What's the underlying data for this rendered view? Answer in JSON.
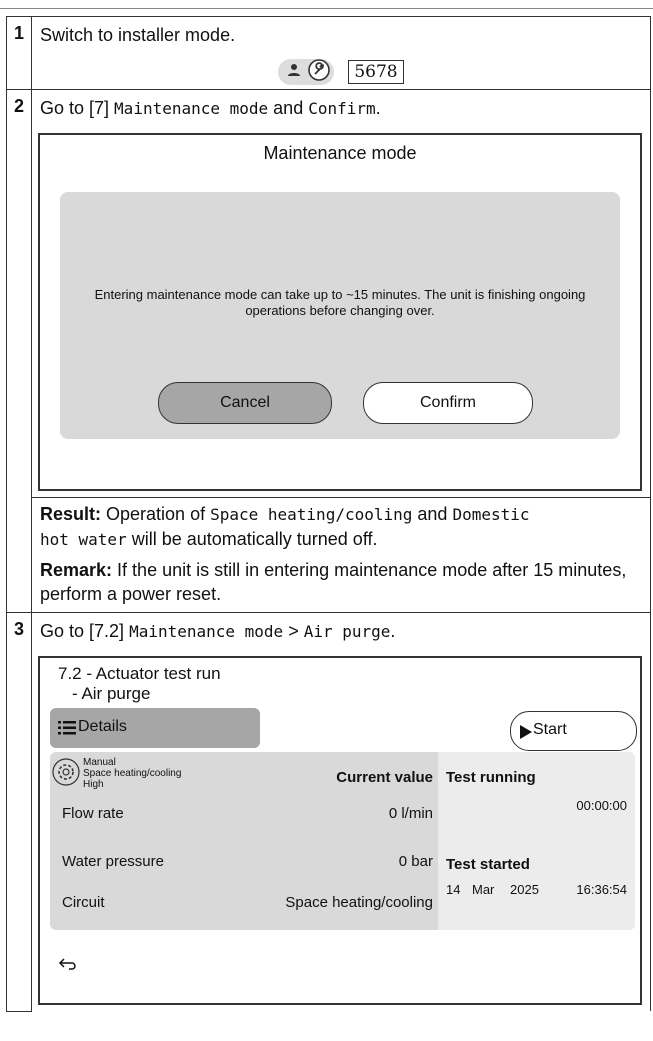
{
  "steps": [
    {
      "num": "1",
      "text": "Switch to installer mode.",
      "code": "5678"
    },
    {
      "num": "2",
      "pre": "Go to [7] ",
      "menu": "Maintenance mode",
      "mid": " and ",
      "action": "Confirm",
      "post": ".",
      "dialog": {
        "title": "Maintenance mode",
        "message": "Entering maintenance mode can take up to ~15 minutes. The unit is finishing ongoing operations before changing over.",
        "cancel": "Cancel",
        "confirm": "Confirm"
      },
      "result_label": "Result:",
      "result_pre": " Operation of ",
      "result_m1": "Space heating/cooling",
      "result_mid": " and ",
      "result_m2a": "Domestic",
      "result_m2b": "hot water",
      "result_post": " will be automatically turned off.",
      "remark_label": "Remark:",
      "remark_text": "  If the unit is still in entering maintenance mode after 15 minutes, perform a power reset."
    },
    {
      "num": "3",
      "pre": "Go to [7.2] ",
      "menu1": "Maintenance mode",
      "sepch": " > ",
      "menu2": "Air purge",
      "post": ".",
      "screen": {
        "title_line1": "7.2 - Actuator test run",
        "title_line2": "- Air purge",
        "details": "Details",
        "start": "Start",
        "mode_line1": "Manual",
        "mode_line2": "Space heating/cooling",
        "mode_line3": "High",
        "current_value": "Current value",
        "rows": [
          {
            "label": "Flow rate",
            "value": "0 l/min"
          },
          {
            "label": "Water pressure",
            "value": "0 bar"
          },
          {
            "label": "Circuit",
            "value": "Space heating/cooling"
          }
        ],
        "test_running": "Test running",
        "elapsed": "00:00:00",
        "test_started": "Test started",
        "date_day": "14",
        "date_month": "Mar",
        "date_year": "2025",
        "date_time": "16:36:54"
      }
    }
  ]
}
